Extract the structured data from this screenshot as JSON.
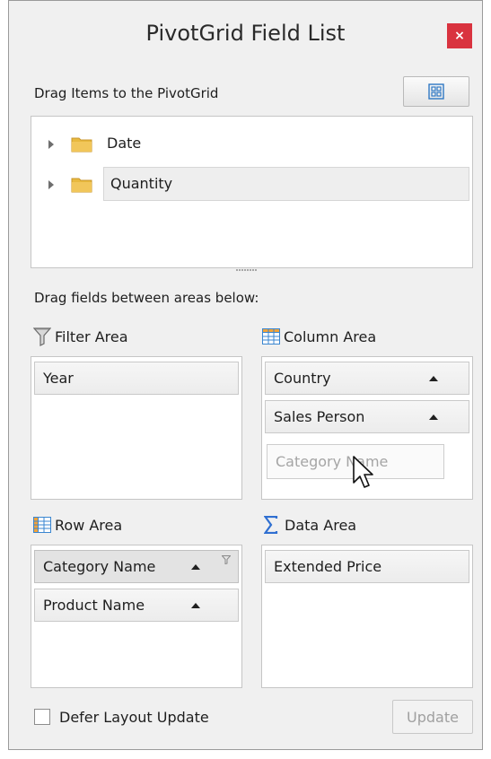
{
  "window": {
    "title": "PivotGrid Field List",
    "close_glyph": "×"
  },
  "field_list": {
    "label": "Drag Items to the PivotGrid",
    "layout_button_icon": "layout-grid-icon",
    "items": [
      {
        "label": "Date",
        "icon": "folder-icon"
      },
      {
        "label": "Quantity",
        "icon": "folder-icon",
        "selected": true
      }
    ]
  },
  "areas_label": "Drag fields between areas below:",
  "filter_area": {
    "label": "Filter Area",
    "icon": "funnel-icon",
    "fields": [
      "Year"
    ]
  },
  "column_area": {
    "label": "Column Area",
    "icon": "table-columns-icon",
    "fields": [
      "Country",
      "Sales Person"
    ],
    "drag_placeholder": "Category Name"
  },
  "row_area": {
    "label": "Row Area",
    "icon": "table-rows-icon",
    "fields": [
      "Category Name",
      "Product Name"
    ]
  },
  "data_area": {
    "label": "Data Area",
    "icon": "sigma-icon",
    "fields": [
      "Extended Price"
    ]
  },
  "footer": {
    "defer_label": "Defer Layout Update",
    "defer_checked": false,
    "update_label": "Update"
  },
  "colors": {
    "close_bg": "#d9333f",
    "table_icon": "#3a86d0",
    "folder": "#e8b93f",
    "sigma": "#2f6fd1"
  }
}
